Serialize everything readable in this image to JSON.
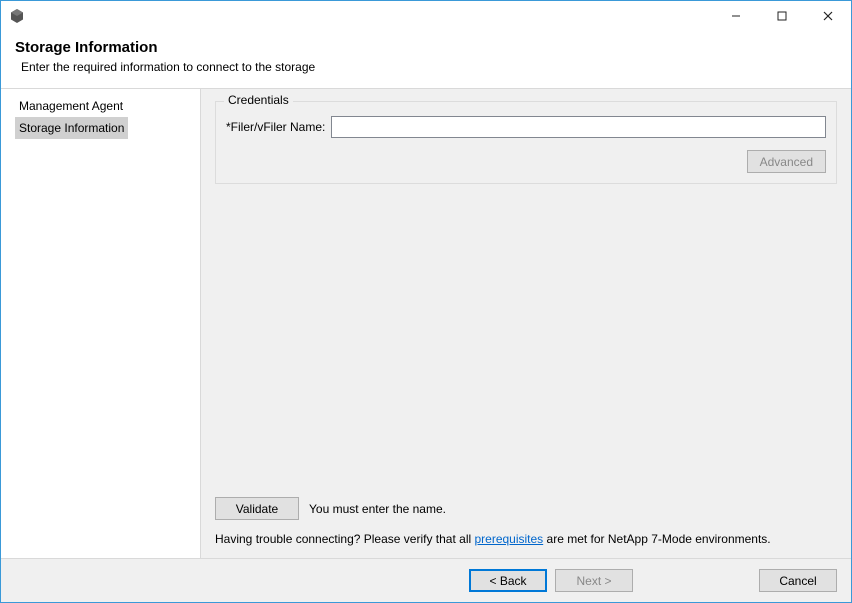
{
  "titlebar": {
    "minimize": "—",
    "maximize": "☐",
    "close": "✕"
  },
  "header": {
    "title": "Storage Information",
    "subtitle": "Enter the required information to connect to the storage"
  },
  "sidebar": {
    "items": [
      {
        "label": "Management Agent",
        "selected": false
      },
      {
        "label": "Storage Information",
        "selected": true
      }
    ]
  },
  "main": {
    "credentials_group_label": "Credentials",
    "filer_label": "*Filer/vFiler Name:",
    "filer_value": "",
    "advanced_label": "Advanced",
    "validate_label": "Validate",
    "validate_message": "You must enter the name.",
    "hint_prefix": "Having trouble connecting? Please verify that all ",
    "hint_link": "prerequisites",
    "hint_suffix": " are met for NetApp 7-Mode environments."
  },
  "footer": {
    "back": "< Back",
    "next": "Next >",
    "cancel": "Cancel"
  }
}
